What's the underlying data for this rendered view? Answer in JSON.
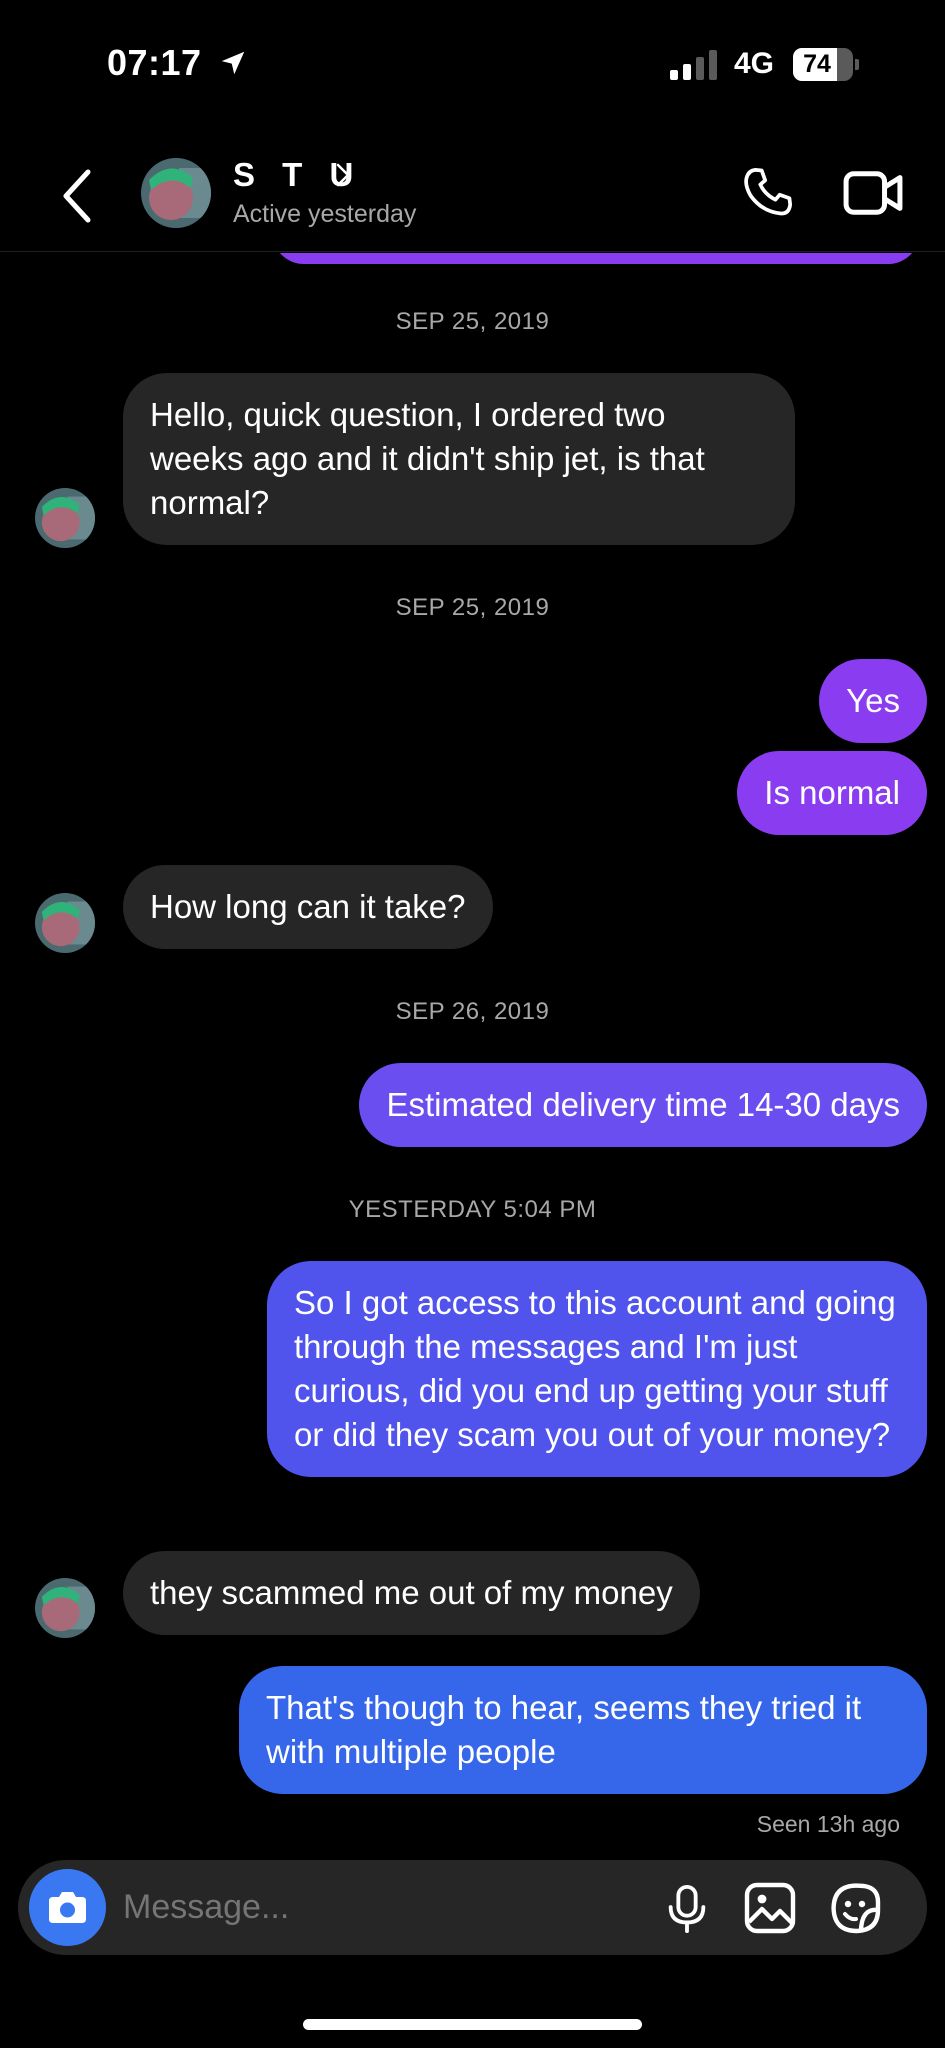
{
  "status_bar": {
    "time": "07:17",
    "network": "4G",
    "battery": "74",
    "battery_level": 0.74
  },
  "header": {
    "name": "S T U",
    "status": "Active yesterday"
  },
  "messages": [
    {
      "kind": "date",
      "text": "SEP 25, 2019"
    },
    {
      "kind": "in",
      "text": "Hello, quick question, I ordered two weeks ago and it didn't ship jet, is that normal?"
    },
    {
      "kind": "date",
      "text": "SEP 25, 2019"
    },
    {
      "kind": "out",
      "text": "Yes",
      "color": "#8a3cf0"
    },
    {
      "kind": "out",
      "text": "Is normal",
      "color": "#8a3cf0"
    },
    {
      "kind": "in",
      "text": "How long can it take?"
    },
    {
      "kind": "date",
      "text": "SEP 26, 2019"
    },
    {
      "kind": "out",
      "text": "Estimated delivery time 14-30 days",
      "color": "#6a4ef0"
    },
    {
      "kind": "date",
      "text": "YESTERDAY 5:04 PM"
    },
    {
      "kind": "out",
      "text": "So I got access to this account and going through the messages and I'm just curious, did you end up getting your stuff or did they scam you out of your money?",
      "color": "#5054ec"
    },
    {
      "kind": "in",
      "text": "they scammed me out of my money"
    },
    {
      "kind": "out",
      "text": "That's though to hear, seems they tried it with multiple people",
      "color": "#3667ea"
    }
  ],
  "seen": "Seen 13h ago",
  "composer": {
    "placeholder": "Message..."
  },
  "colors": {
    "bubble_in": "#262626",
    "accent_purple": "#8a3cf0",
    "accent_blue": "#3a78f2"
  },
  "icons": [
    "location-arrow-icon",
    "signal-icon",
    "back-chevron-icon",
    "phone-icon",
    "video-camera-icon",
    "camera-icon",
    "microphone-icon",
    "gallery-icon",
    "sticker-icon"
  ]
}
